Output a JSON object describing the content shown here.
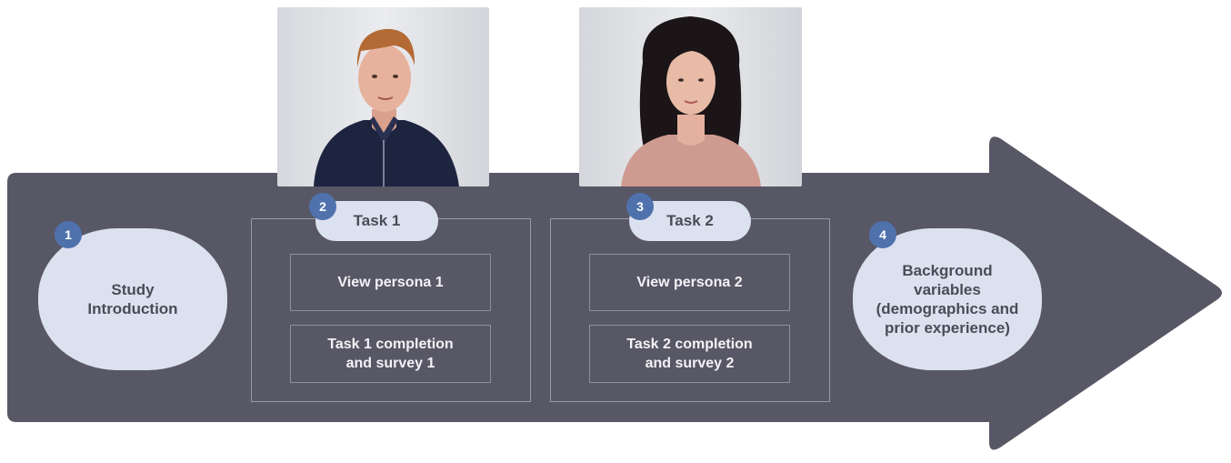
{
  "colors": {
    "arrow": "#585766",
    "blob": "#dce1f0",
    "badge": "#4f72ad",
    "text_dark": "#4a4b58",
    "text_light": "#f2f2f6"
  },
  "stages": [
    {
      "number": "1",
      "label": "Study Introduction"
    },
    {
      "number": "2",
      "label": "Task 1",
      "steps": [
        "View persona 1",
        "Task 1 completion and survey 1"
      ]
    },
    {
      "number": "3",
      "label": "Task 2",
      "steps": [
        "View persona 2",
        "Task 2 completion and survey 2"
      ]
    },
    {
      "number": "4",
      "label": "Background variables (demographics and prior experience)"
    }
  ]
}
